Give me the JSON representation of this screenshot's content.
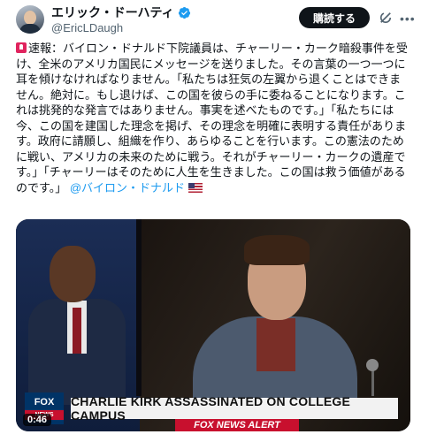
{
  "author": {
    "name": "エリック・ドーハティ",
    "handle": "@EricLDaugh",
    "verified": true
  },
  "actions": {
    "subscribe_label": "購読する",
    "grok_icon": "grok-icon",
    "more_icon": "more-icon"
  },
  "tweet": {
    "prefix_icon": "siren-icon",
    "text": "速報：バイロン・ドナルド下院議員は、チャーリー・カーク暗殺事件を受け、全米のアメリカ国民にメッセージを送りました。その言葉の一つ一つに耳を傾けなければなりません。「私たちは狂気の左翼から退くことはできません。絶対に。もし退けば、この国を彼らの手に委ねることになります。これは挑発的な発言ではありません。事実を述べたものです。」「私たちには今、この国を建国した理念を掲げ、その理念を明確に表明する責任があります。政府に請願し、組織を作り、あらゆることを行います。この憲法のために戦い、アメリカの未来のために戦う。それがチャーリー・カークの遺産です。」「チャーリーはそのために人生を生きました。この国は救う価値があるのです。」",
    "mention": "@バイロン・ドナルド",
    "suffix_icon": "us-flag-icon"
  },
  "media": {
    "network": "FOX",
    "network_sub": "NEWS",
    "headline": "CHARLIE KIRK ASSASSINATED ON COLLEGE CAMPUS",
    "sub_banner": "FOX NEWS ALERT",
    "duration": "0:46"
  }
}
